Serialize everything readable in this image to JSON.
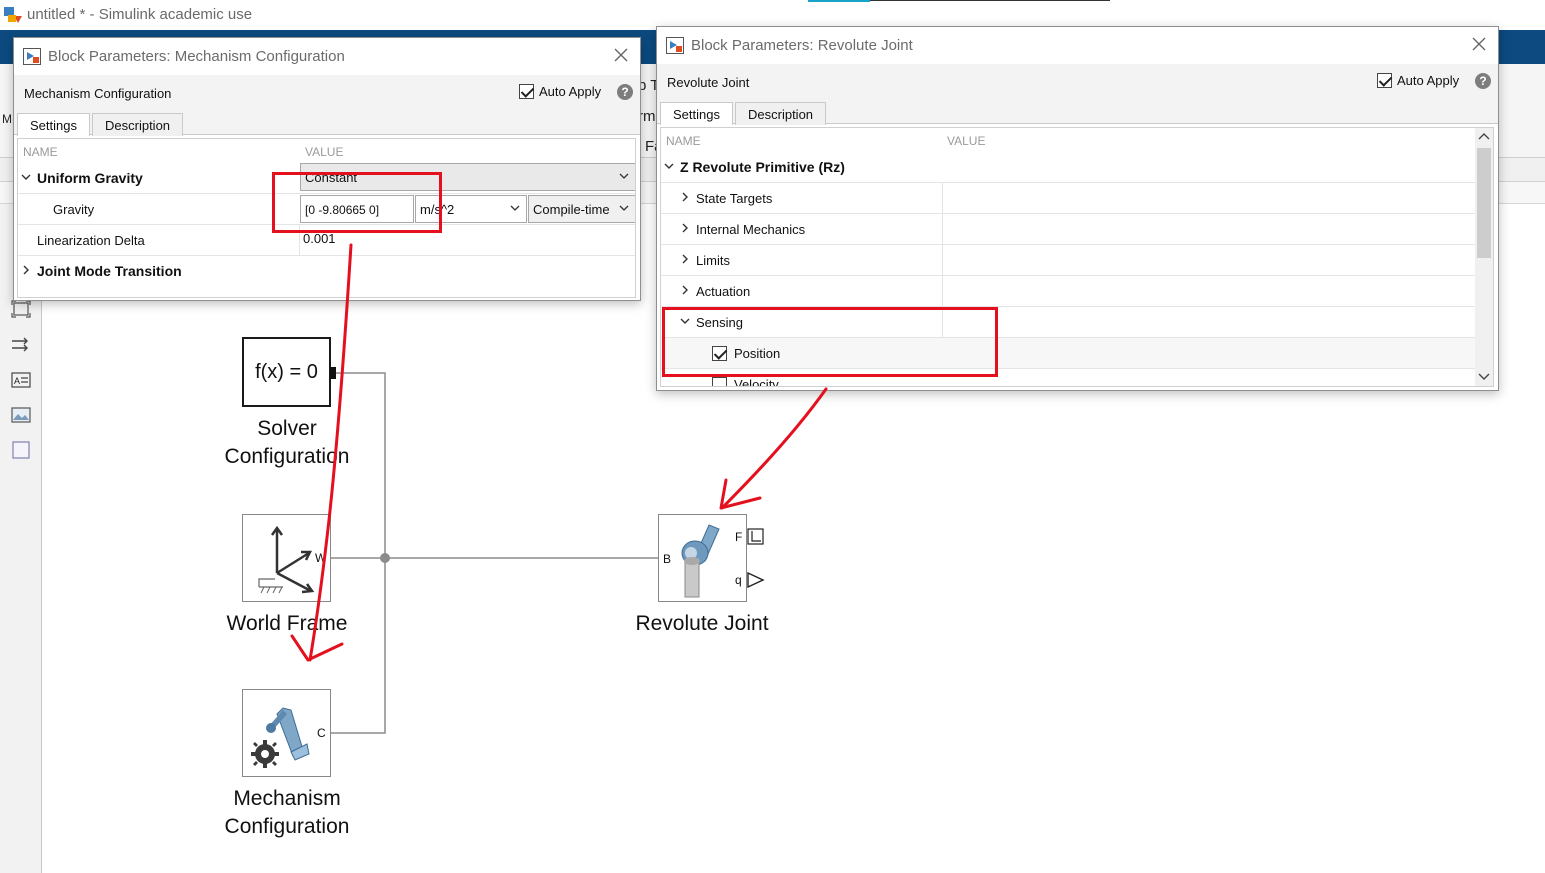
{
  "window": {
    "title": "untitled * - Simulink academic use"
  },
  "ribbon_fragments": {
    "frag_p": "p T",
    "frag_rm": "rm",
    "frag_fa": "Fa",
    "frag_m": "M"
  },
  "palette": {
    "icons": [
      "fit-view-icon",
      "signal-lines-icon",
      "annotation-icon",
      "image-icon",
      "area-icon"
    ]
  },
  "mech_dialog": {
    "title": "Block Parameters: Mechanism Configuration",
    "header_name": "Mechanism Configuration",
    "auto_apply_label": "Auto Apply",
    "auto_apply_checked": true,
    "help_glyph": "?",
    "tabs": [
      "Settings",
      "Description"
    ],
    "active_tab": "Settings",
    "columns": {
      "name": "NAME",
      "value": "VALUE"
    },
    "rows": {
      "uniform_gravity": {
        "label": "Uniform Gravity",
        "value": "Constant"
      },
      "gravity": {
        "label": "Gravity",
        "value": "[0 -9.80665 0]",
        "unit": "m/s^2",
        "mode": "Compile-time"
      },
      "linearization_delta": {
        "label": "Linearization Delta",
        "value": "0.001"
      },
      "joint_mode_transition": {
        "label": "Joint Mode Transition"
      }
    }
  },
  "rev_dialog": {
    "title": "Block Parameters: Revolute Joint",
    "header_name": "Revolute Joint",
    "auto_apply_label": "Auto Apply",
    "auto_apply_checked": true,
    "help_glyph": "?",
    "tabs": [
      "Settings",
      "Description"
    ],
    "active_tab": "Settings",
    "columns": {
      "name": "NAME",
      "value": "VALUE"
    },
    "primitive": "Z Revolute Primitive (Rz)",
    "sections": {
      "state_targets": "State Targets",
      "internal_mechanics": "Internal Mechanics",
      "limits": "Limits",
      "actuation": "Actuation",
      "sensing": "Sensing"
    },
    "sensing_items": {
      "position": {
        "label": "Position",
        "checked": true
      },
      "velocity": {
        "label": "Velocity",
        "checked": false
      }
    }
  },
  "diagram": {
    "solver": {
      "glyph": "f(x) = 0",
      "label_line1": "Solver",
      "label_line2": "Configuration"
    },
    "world_frame": {
      "label": "World Frame",
      "port": "W"
    },
    "mechanism": {
      "label_line1": "Mechanism",
      "label_line2": "Configuration",
      "port": "C"
    },
    "revolute": {
      "label": "Revolute Joint",
      "port_b": "B",
      "port_f": "F",
      "port_q": "q"
    }
  },
  "annotation_color": "#e4101e"
}
